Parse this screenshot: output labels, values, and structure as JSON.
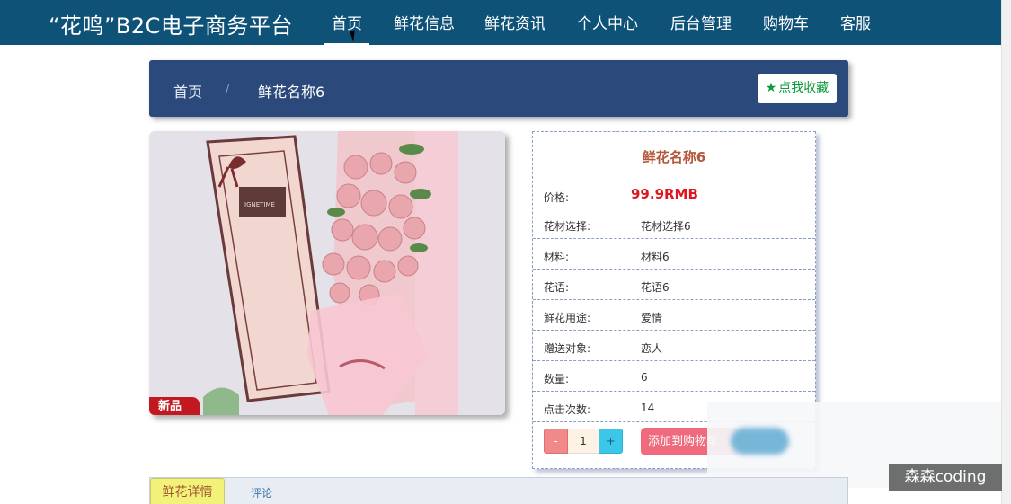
{
  "header": {
    "brand": "“花鸣”B2C电子商务平台",
    "nav": [
      "首页",
      "鲜花信息",
      "鲜花资讯",
      "个人中心",
      "后台管理",
      "购物车",
      "客服"
    ],
    "active_index": 0
  },
  "breadcrumb": {
    "home": "首页",
    "separator": "/",
    "current": "鲜花名称6"
  },
  "favorite_button": {
    "icon": "star-icon",
    "label": "点我收藏"
  },
  "product": {
    "image_badge": "新品",
    "name": "鲜花名称6",
    "price_label": "价格:",
    "price": "99.9RMB",
    "fields": [
      {
        "label": "花材选择:",
        "value": "花材选择6"
      },
      {
        "label": "材料:",
        "value": "材料6"
      },
      {
        "label": "花语:",
        "value": "花语6"
      },
      {
        "label": "鲜花用途:",
        "value": "爱情"
      },
      {
        "label": "赠送对象:",
        "value": "恋人"
      },
      {
        "label": "数量:",
        "value": "6"
      },
      {
        "label": "点击次数:",
        "value": "14"
      }
    ],
    "quantity": {
      "minus": "-",
      "value": "1",
      "plus": "+"
    },
    "add_to_cart": "添加到购物车"
  },
  "tabs": [
    "鲜花详情",
    "评论"
  ],
  "watermark": "森森coding",
  "colors": {
    "nav_bg": "#0f5278",
    "breadcrumb_bg": "#2b4a7b",
    "price": "#e0151d",
    "title": "#b4563a",
    "cart_button": "#ee6a7c"
  }
}
